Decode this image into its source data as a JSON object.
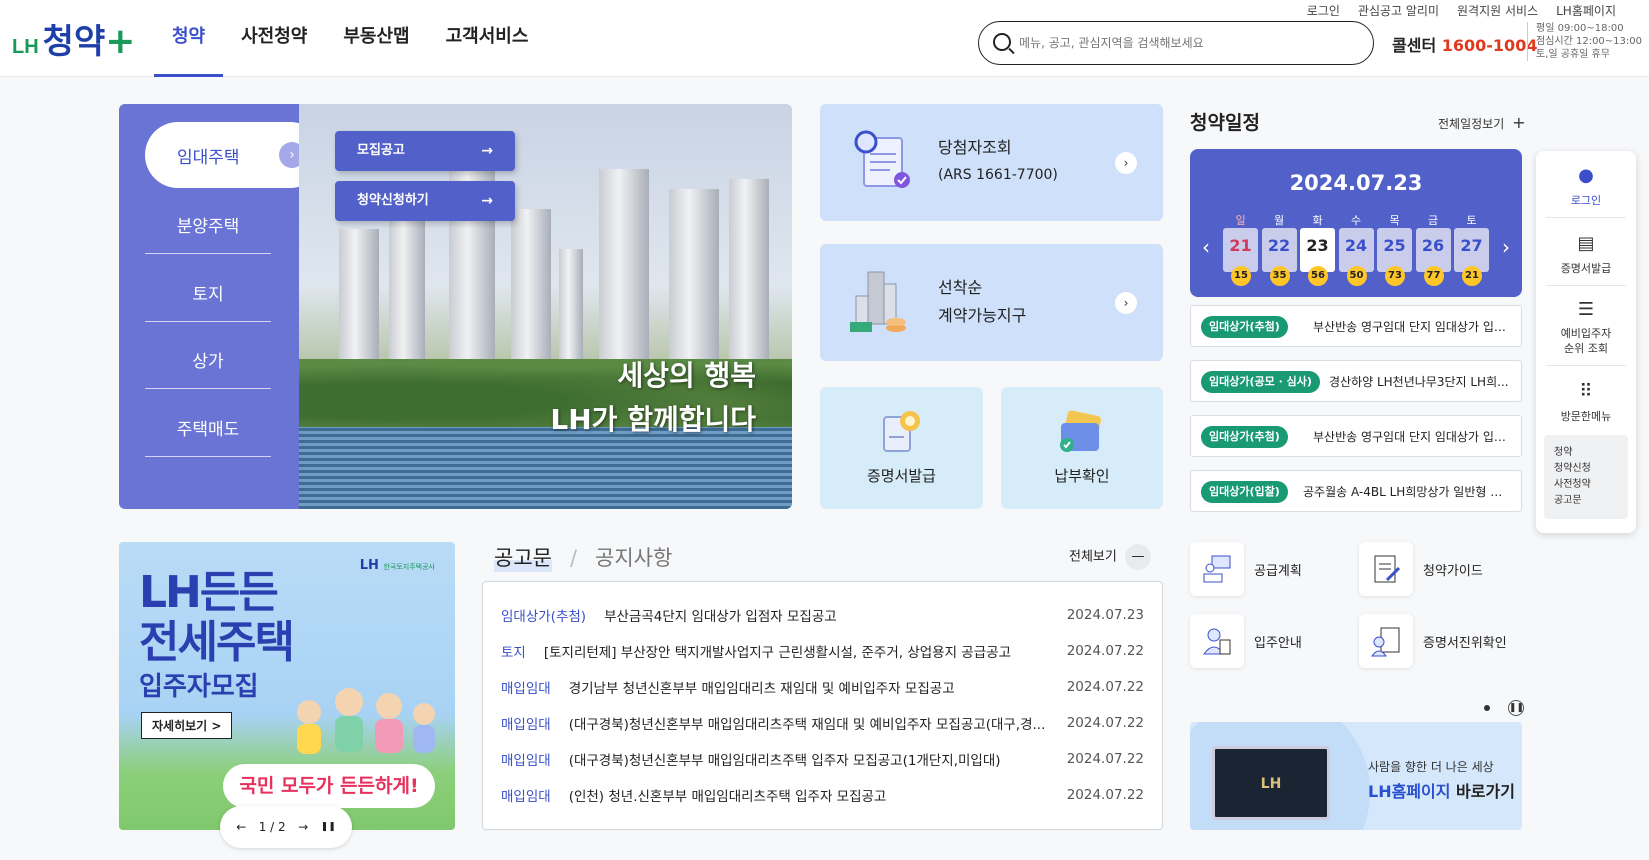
{
  "header": {
    "logo": {
      "lh": "LH",
      "main": "청약",
      "plus": "+"
    },
    "nav": [
      "청약",
      "사전청약",
      "부동산맵",
      "고객서비스"
    ],
    "util": [
      "로그인",
      "관심공고 알리미",
      "원격지원 서비스",
      "LH홈페이지"
    ],
    "search_placeholder": "메뉴, 공고, 관심지역을 검색해보세요",
    "callcenter_label": "콜센터",
    "callcenter_number": "1600-1004",
    "call_hours": [
      "평일 09:00~18:00",
      "점심시간 12:00~13:00",
      "토,일 공휴일 휴무"
    ]
  },
  "sidemenu": {
    "active": "임대주택",
    "items": [
      "분양주택",
      "토지",
      "상가",
      "주택매도"
    ]
  },
  "hero": {
    "buttons": [
      "모집공고",
      "청약신청하기"
    ],
    "text": [
      "세상의 행복",
      "LH가 함께합니다"
    ]
  },
  "cards": {
    "winner": {
      "title": "당첨자조회",
      "sub": "(ARS 1661-7700)"
    },
    "firstcome": {
      "title": "선착순",
      "sub": "계약가능지구"
    },
    "cert": "증명서발급",
    "payment": "납부확인"
  },
  "schedule": {
    "title": "청약일정",
    "all_label": "전체일정보기",
    "date": "2024.07.23",
    "days": [
      {
        "dow": "일",
        "day": "21",
        "count": "15"
      },
      {
        "dow": "월",
        "day": "22",
        "count": "35"
      },
      {
        "dow": "화",
        "day": "23",
        "count": "56"
      },
      {
        "dow": "수",
        "day": "24",
        "count": "50"
      },
      {
        "dow": "목",
        "day": "25",
        "count": "73"
      },
      {
        "dow": "금",
        "day": "26",
        "count": "77"
      },
      {
        "dow": "토",
        "day": "27",
        "count": "21"
      }
    ],
    "items": [
      {
        "tag": "임대상가(추첨)",
        "text": "부산반송 영구임대 단지 임대상가 입점자 ..."
      },
      {
        "tag": "임대상가(공모 · 심사)",
        "text": "경산하양 LH천년나무3단지 LH희..."
      },
      {
        "tag": "임대상가(추첨)",
        "text": "부산반송 영구임대 단지 임대상가 입점자 ..."
      },
      {
        "tag": "임대상가(입찰)",
        "text": "공주월송 A-4BL LH희망상가 일반형 입..."
      }
    ]
  },
  "quicklinks": [
    "공급계획",
    "청약가이드",
    "입주안내",
    "증명서진위확인"
  ],
  "float": {
    "items": [
      "로그인",
      "증명서발급",
      "예비입주자 순위 조회",
      "방문한메뉴"
    ],
    "visited": [
      "청약",
      "청약신청",
      "사전청약",
      "공고문"
    ]
  },
  "promo": {
    "title1": "LH든든",
    "title2": "전세주택",
    "subtitle": "입주자모집",
    "button": "자세히보기 >",
    "bubble": "국민 모두가 든든하게!",
    "logo": "LH",
    "logo_sub": "한국토지주택공사",
    "pager": {
      "prev": "←",
      "page": "1 / 2",
      "next": "→",
      "pause": "❚❚"
    }
  },
  "notice": {
    "tabs": [
      "공고문",
      "공지사항"
    ],
    "more": "전체보기",
    "rows": [
      {
        "cat": "임대상가(추첨)",
        "title": "부산금곡4단지 임대상가 입점자 모집공고",
        "date": "2024.07.23"
      },
      {
        "cat": "토지",
        "title": "[토지리턴제] 부산장안 택지개발사업지구 근린생활시설, 준주거, 상업용지 공급공고",
        "date": "2024.07.22"
      },
      {
        "cat": "매입임대",
        "title": "경기남부 청년신혼부부 매입임대리츠 재임대 및 예비입주자 모집공고",
        "date": "2024.07.22"
      },
      {
        "cat": "매입임대",
        "title": "(대구경북)청년신혼부부 매입임대리츠주택 재임대 및 예비입주자 모집공고(대구,경...",
        "date": "2024.07.22"
      },
      {
        "cat": "매입임대",
        "title": "(대구경북)청년신혼부부 매입임대리츠주택 입주자 모집공고(1개단지,미입대)",
        "date": "2024.07.22"
      },
      {
        "cat": "매입임대",
        "title": "(인천) 청년.신혼부부 매입임대리츠주택 입주자 모집공고",
        "date": "2024.07.22"
      }
    ]
  },
  "lhbanner": {
    "line1": "사람을 향한 더 나은 세상",
    "highlight": "LH홈페이지",
    "rest": " 바로가기",
    "screen": "LH"
  }
}
